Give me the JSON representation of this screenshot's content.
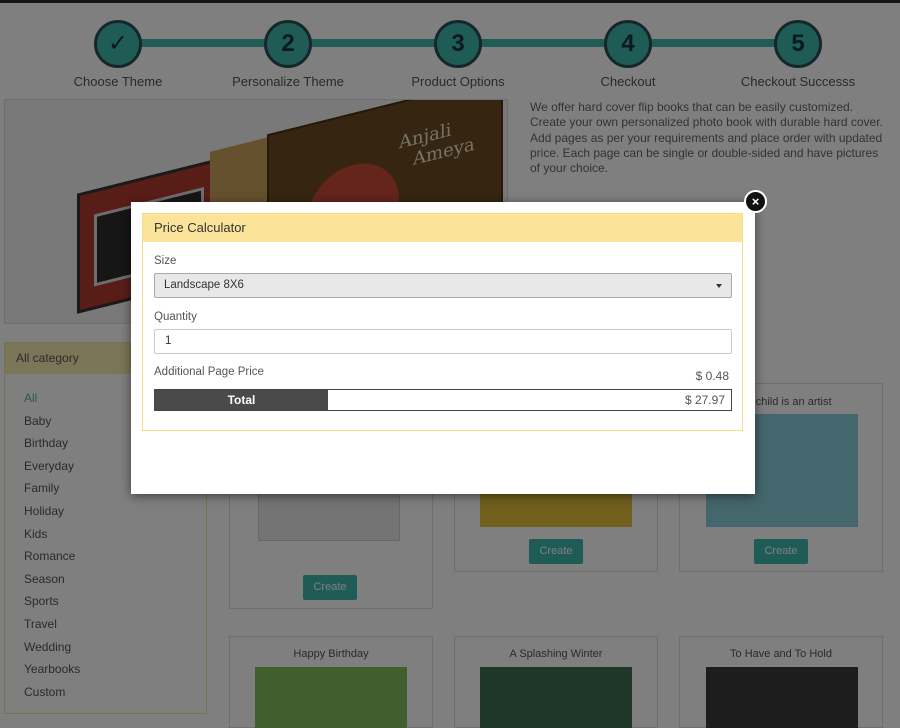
{
  "steps": [
    {
      "badge": "✓",
      "label": "Choose Theme"
    },
    {
      "badge": "2",
      "label": "Personalize Theme"
    },
    {
      "badge": "3",
      "label": "Product Options"
    },
    {
      "badge": "4",
      "label": "Checkout"
    },
    {
      "badge": "5",
      "label": "Checkout Successs"
    }
  ],
  "hero": {
    "names_line1": "Anjali",
    "names_line2": "Ameya"
  },
  "intro": "We offer hard cover flip books that can be easily customized. Create your own personalized photo book with durable hard cover. Add pages as per your requirements and place order with updated price. Each page can be single or double-sided and have pictures of your choice.",
  "sidebar": {
    "title": "All category",
    "items": [
      "All",
      "Baby",
      "Birthday",
      "Everyday",
      "Family",
      "Holiday",
      "Kids",
      "Romance",
      "Season",
      "Sports",
      "Travel",
      "Wedding",
      "Yearbooks",
      "Custom"
    ]
  },
  "cards": [
    {
      "title": "",
      "button": "Create"
    },
    {
      "title": "",
      "button": "Create"
    },
    {
      "title": "Your child is an artist",
      "button": "Create"
    },
    {
      "title": "Happy Birthday"
    },
    {
      "title": "A Splashing Winter"
    },
    {
      "title": "To Have and To Hold"
    }
  ],
  "modal": {
    "title": "Price Calculator",
    "close": "×",
    "size_label": "Size",
    "size_value": "Landscape 8X6",
    "quantity_label": "Quantity",
    "quantity_value": "1",
    "additional_label": "Additional Page Price",
    "additional_value": "$ 0.48",
    "total_label": "Total",
    "total_value": "$ 27.97"
  },
  "colors": {
    "accent": "#3fb9ad",
    "panel_header": "#fbe49a",
    "total_bar": "#4a4a4a"
  }
}
